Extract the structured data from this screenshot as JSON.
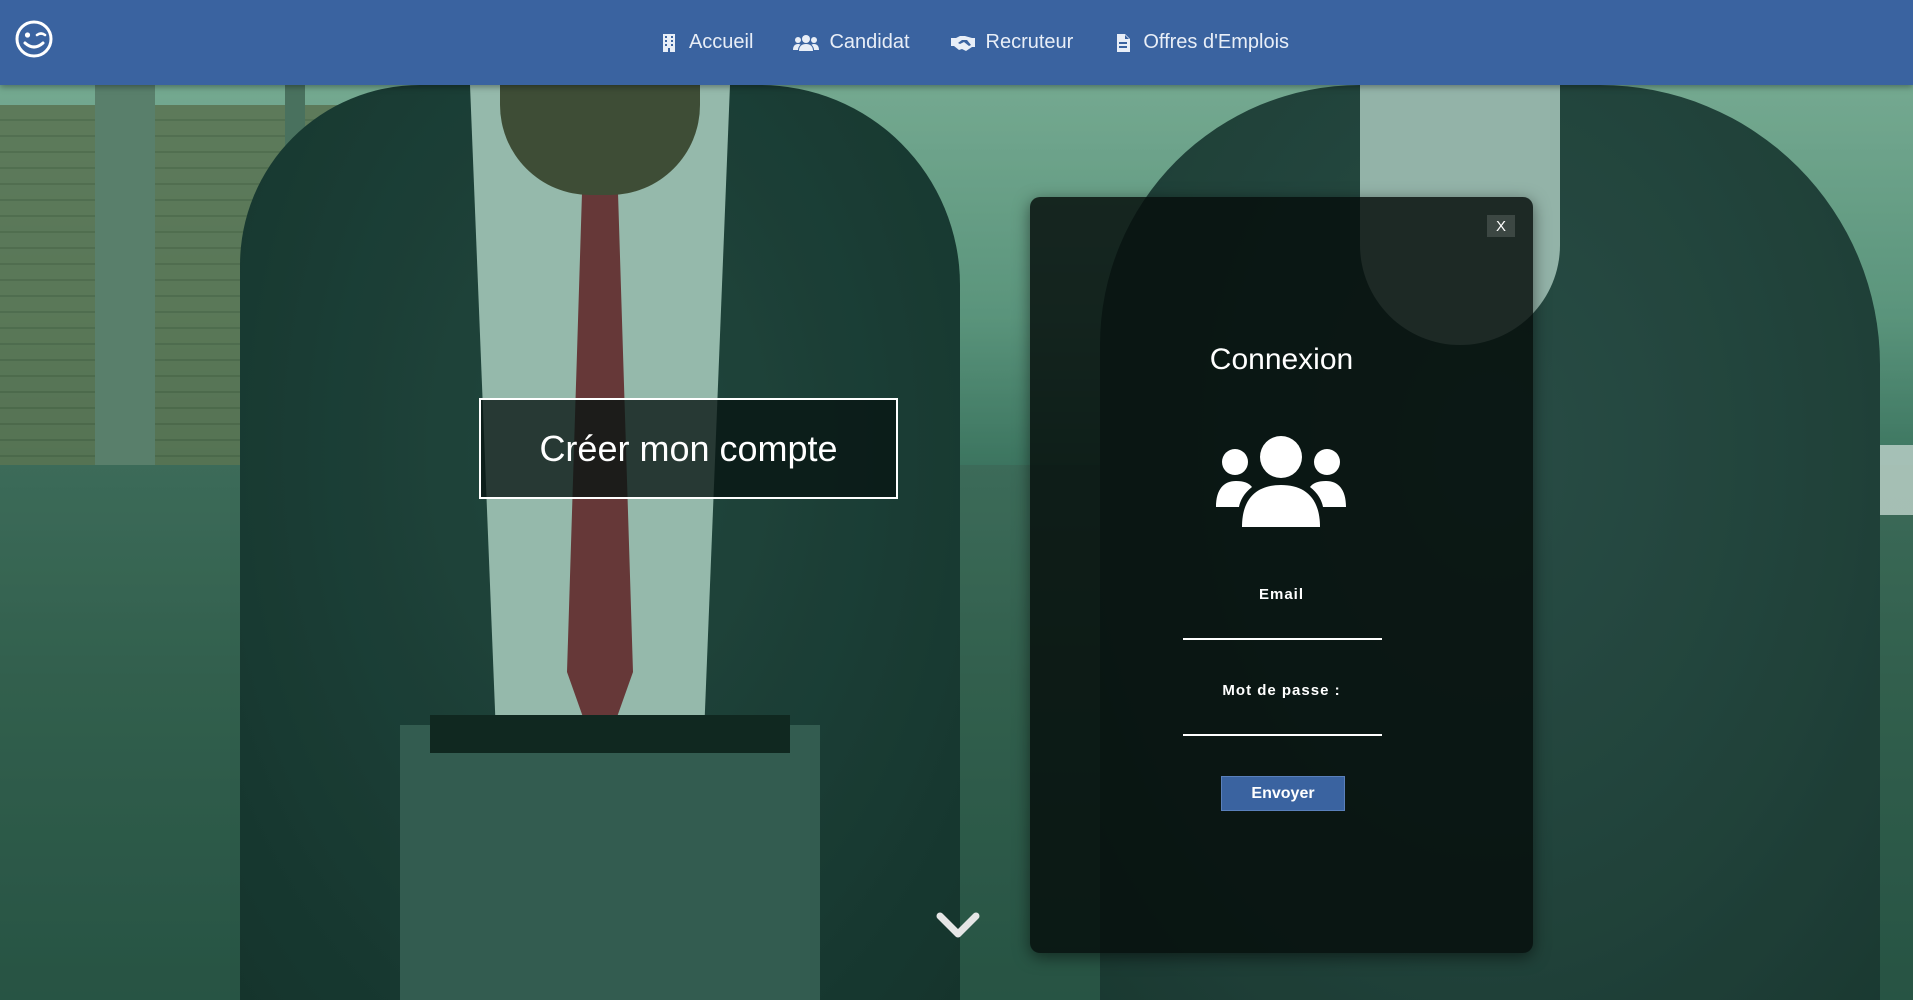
{
  "header": {
    "logo_icon": "wink-smiley-icon",
    "nav": [
      {
        "label": "Accueil",
        "icon": "building-icon"
      },
      {
        "label": "Candidat",
        "icon": "users-icon"
      },
      {
        "label": "Recruteur",
        "icon": "handshake-icon"
      },
      {
        "label": "Offres d'Emplois",
        "icon": "document-icon"
      }
    ],
    "color": "#3a63a0"
  },
  "hero": {
    "create_account_label": "Créer mon compte",
    "scroll_icon": "chevron-down-icon"
  },
  "login": {
    "close_label": "X",
    "title": "Connexion",
    "icon": "users-icon",
    "email_label": "Email",
    "email_value": "",
    "password_label": "Mot de passe :",
    "password_value": "",
    "submit_label": "Envoyer"
  }
}
